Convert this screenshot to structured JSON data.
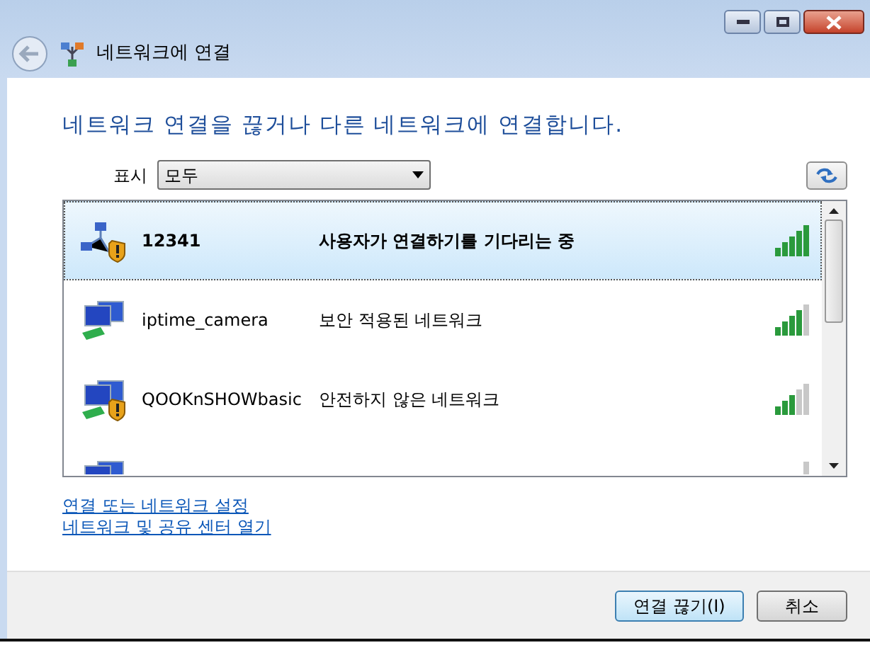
{
  "window": {
    "title": "네트워크에 연결"
  },
  "heading": "네트워크 연결을 끊거나 다른 네트워크에 연결합니다.",
  "filter": {
    "label": "표시",
    "value": "모두"
  },
  "networks": [
    {
      "kind": "adhoc",
      "warning": true,
      "name": "12341",
      "status": "사용자가 연결하기를 기다리는 중",
      "level": 1,
      "selected": true
    },
    {
      "kind": "wireless",
      "warning": false,
      "name": "iptime_camera",
      "status": "보안 적용된 네트워크",
      "level": 0.8,
      "selected": false
    },
    {
      "kind": "wireless",
      "warning": true,
      "name": "QOOKnSHOWbasic",
      "status": "안전하지 않은 네트워크",
      "level": 0.6,
      "selected": false
    },
    {
      "kind": "wireless",
      "selected": false
    }
  ],
  "links": [
    "연결 또는 네트워크 설정",
    "네트워크 및 공유 센터 열기"
  ],
  "buttons": [
    {
      "label": "연결 끊기(I)",
      "default": true
    },
    {
      "label": "취소",
      "default": false
    }
  ]
}
